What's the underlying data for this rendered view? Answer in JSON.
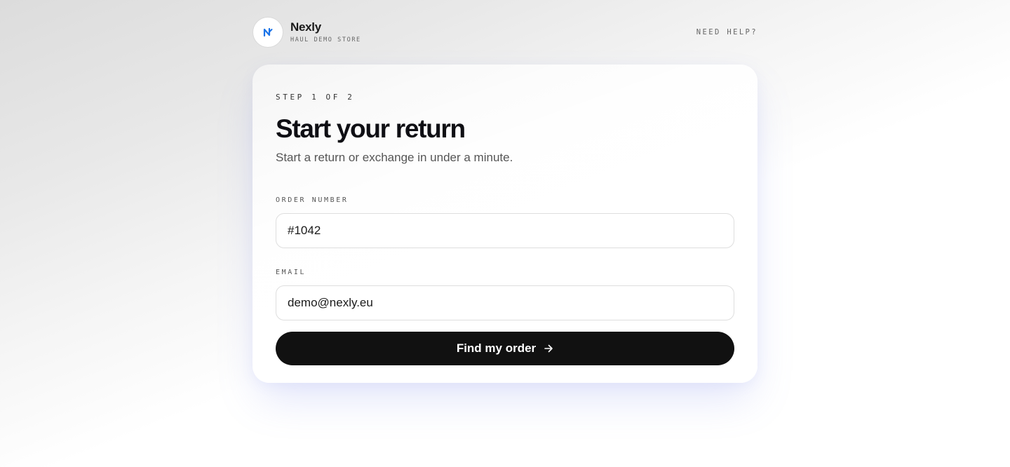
{
  "brand": {
    "name": "Nexly",
    "subtitle": "HAUL DEMO STORE",
    "logo_glyph": "N",
    "logo_color": "#1a73e8"
  },
  "header": {
    "help_label": "NEED HELP?"
  },
  "form": {
    "step": "STEP 1 OF 2",
    "title": "Start your return",
    "subtitle": "Start a return or exchange in under a minute.",
    "order_label": "ORDER NUMBER",
    "order_value": "#1042",
    "email_label": "EMAIL",
    "email_value": "demo@nexly.eu",
    "submit_label": "Find my order",
    "submit_icon": "arrow-right-icon"
  }
}
